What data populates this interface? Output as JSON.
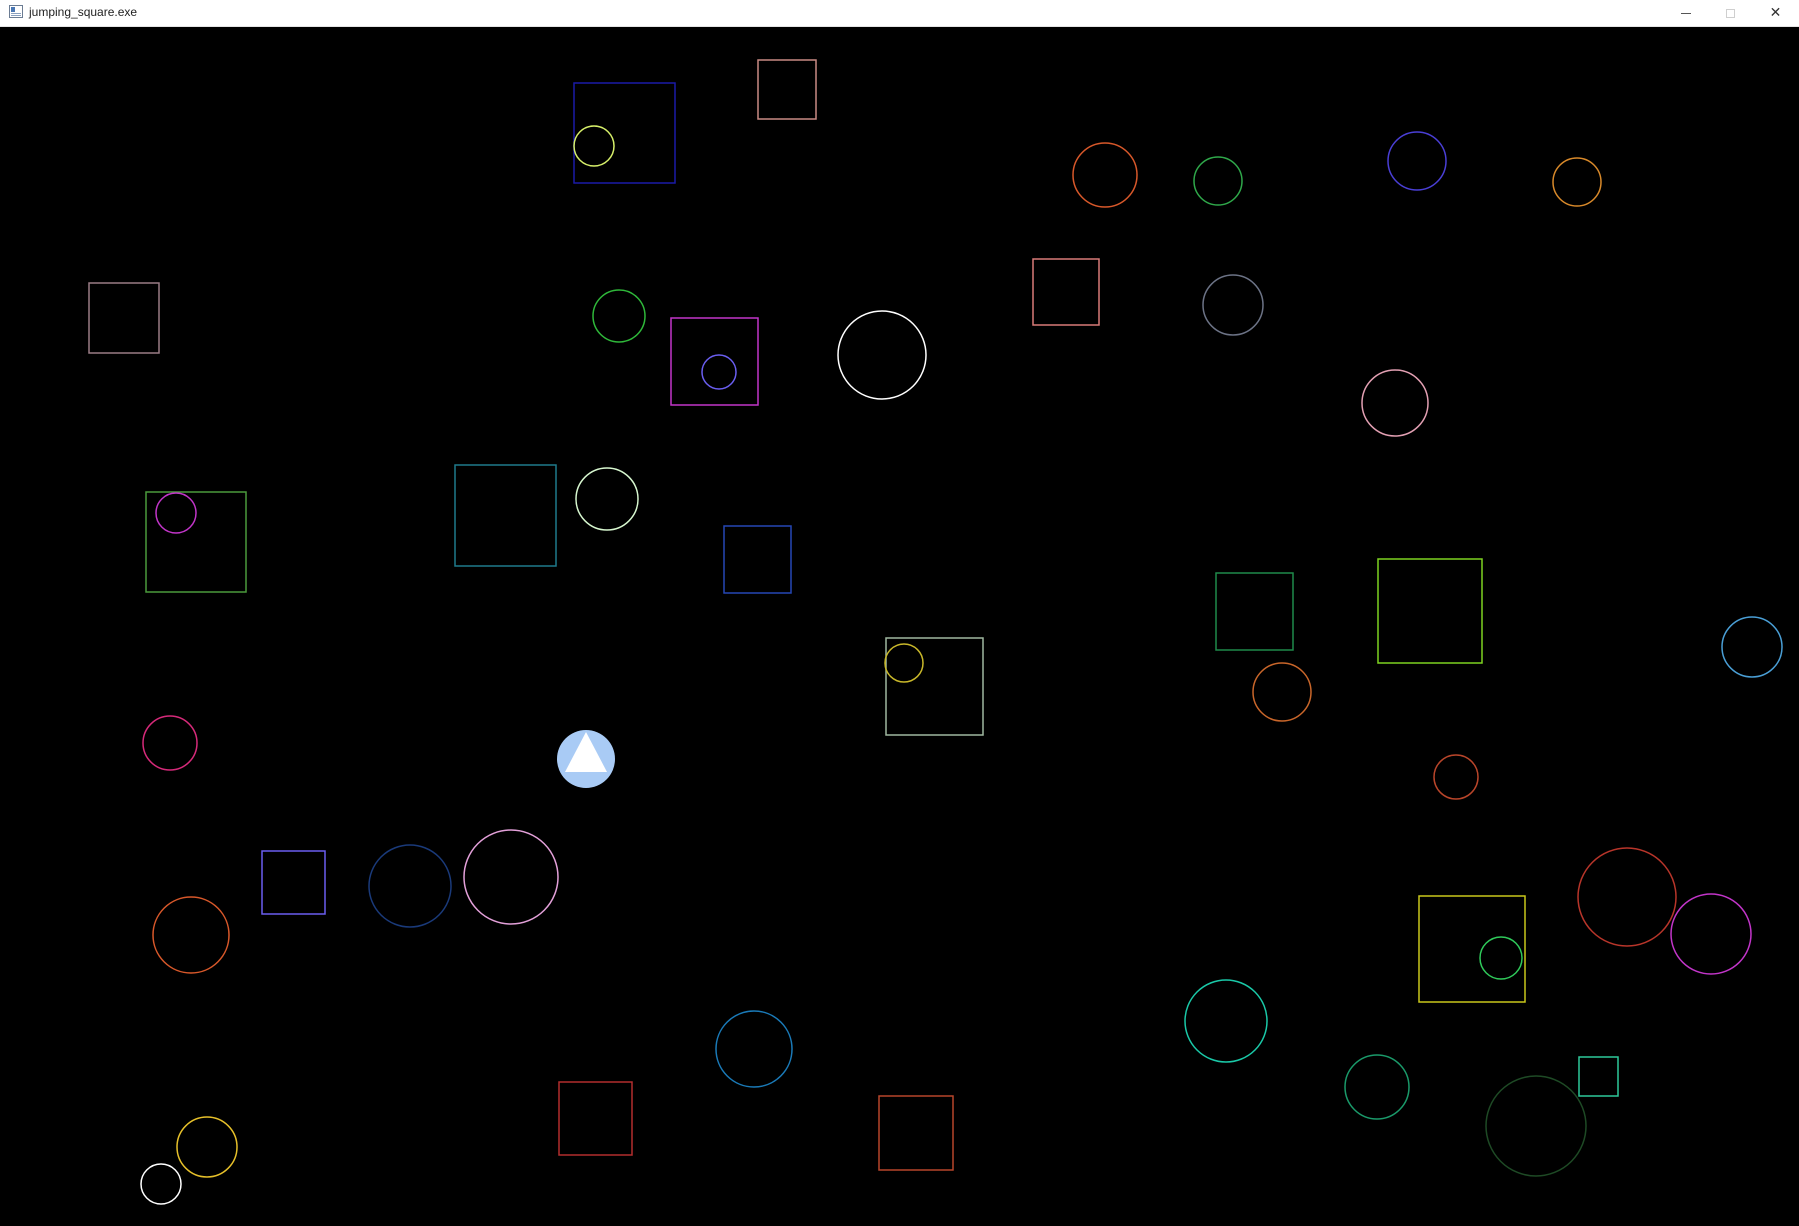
{
  "window": {
    "title": "jumping_square.exe",
    "icon": "app-window-icon",
    "controls": {
      "minimize_icon": "minimize-icon",
      "maximize_icon": "maximize-icon",
      "close_icon": "close-icon",
      "close_glyph": "✕"
    }
  },
  "game": {
    "background_color": "#000000",
    "player": {
      "shape": "circle-with-triangle",
      "circle_color": "#a9cbf5",
      "triangle_color": "#ffffff"
    },
    "obstacle_colors": {
      "navy": "#1a1aa8",
      "salmon": "#c98b84",
      "yellow_green": "#d7f06a",
      "orange": "#d8582a",
      "green": "#2fa84a",
      "blue_violet": "#4a3fd6",
      "amber": "#d8892a",
      "mauve": "#9a7c86",
      "magenta": "#c235c9",
      "white": "#ffffff",
      "slate": "#6c7386",
      "pink": "#e3a0b3",
      "teal": "#1f7a8c",
      "mint": "#d7f7cf",
      "blue": "#2547b5"
    }
  }
}
